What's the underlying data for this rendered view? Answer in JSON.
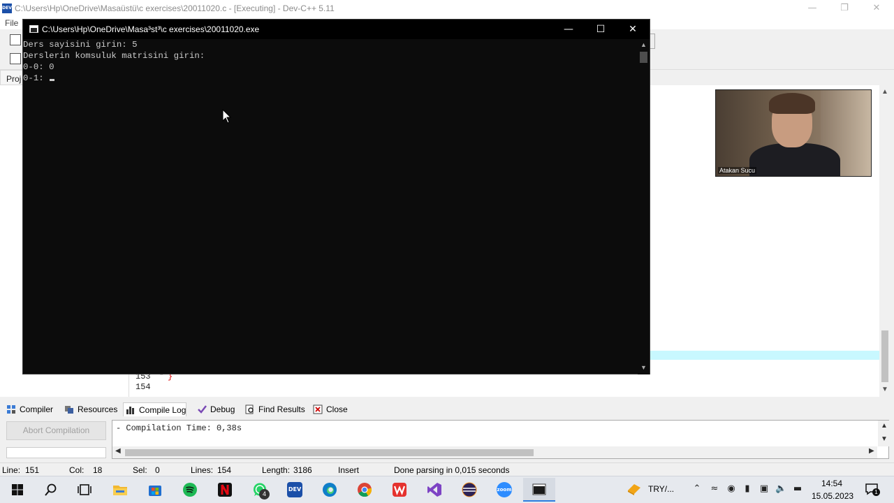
{
  "devcpp": {
    "title": "C:\\Users\\Hp\\OneDrive\\Masaüstü\\c exercises\\20011020.c - [Executing] - Dev-C++ 5.11",
    "menu_file": "File",
    "project_tab": "Proj",
    "gutter_lines": [
      "153",
      "154"
    ],
    "brace": "}"
  },
  "console": {
    "title": "C:\\Users\\Hp\\OneDrive\\Masa³st³\\c exercises\\20011020.exe",
    "lines": [
      "Ders sayisini girin: 5",
      "Derslerin komsuluk matrisini girin:",
      "0-0: 0",
      "0-1: "
    ]
  },
  "webcam": {
    "participant_name": "Atakan Sucu"
  },
  "bottom_tabs": [
    {
      "label": "Compiler",
      "icon": "grid-icon"
    },
    {
      "label": "Resources",
      "icon": "resources-icon"
    },
    {
      "label": "Compile Log",
      "icon": "chart-icon"
    },
    {
      "label": "Debug",
      "icon": "check-icon"
    },
    {
      "label": "Find Results",
      "icon": "find-icon"
    },
    {
      "label": "Close",
      "icon": "close-icon"
    }
  ],
  "active_tab": "Compile Log",
  "abort_button": "Abort Compilation",
  "log_line": "- Compilation Time: 0,38s",
  "status": {
    "line_label": "Line:",
    "line": "151",
    "col_label": "Col:",
    "col": "18",
    "sel_label": "Sel:",
    "sel": "0",
    "lines_label": "Lines:",
    "lines": "154",
    "length_label": "Length:",
    "length": "3186",
    "mode": "Insert",
    "message": "Done parsing in 0,015 seconds"
  },
  "taskbar": {
    "apps": [
      {
        "name": "start",
        "icon": "windows-icon"
      },
      {
        "name": "search",
        "icon": "search-icon"
      },
      {
        "name": "task-view",
        "icon": "task-view-icon"
      },
      {
        "name": "file-explorer",
        "icon": "folder-icon"
      },
      {
        "name": "store",
        "icon": "store-icon"
      },
      {
        "name": "spotify",
        "icon": "spotify-icon"
      },
      {
        "name": "netflix",
        "icon": "netflix-icon"
      },
      {
        "name": "whatsapp",
        "icon": "whatsapp-icon",
        "badge": "4"
      },
      {
        "name": "devcpp",
        "icon": "devcpp-icon",
        "glyph": "DEV"
      },
      {
        "name": "edge",
        "icon": "edge-icon"
      },
      {
        "name": "chrome",
        "icon": "chrome-icon"
      },
      {
        "name": "wps",
        "icon": "wps-icon"
      },
      {
        "name": "visual-studio",
        "icon": "vs-icon"
      },
      {
        "name": "eclipse",
        "icon": "eclipse-icon"
      },
      {
        "name": "zoom",
        "icon": "zoom-icon",
        "glyph": "zoom"
      },
      {
        "name": "console",
        "icon": "console-icon"
      }
    ],
    "currency": "TRY/...",
    "time": "14:54",
    "date": "15.05.2023",
    "notification_count": "1"
  },
  "colors": {
    "accent": "#2b7de0",
    "console_bg": "#0c0c0c",
    "console_text": "#cccccc",
    "highlight_line": "#c8f8ff"
  }
}
